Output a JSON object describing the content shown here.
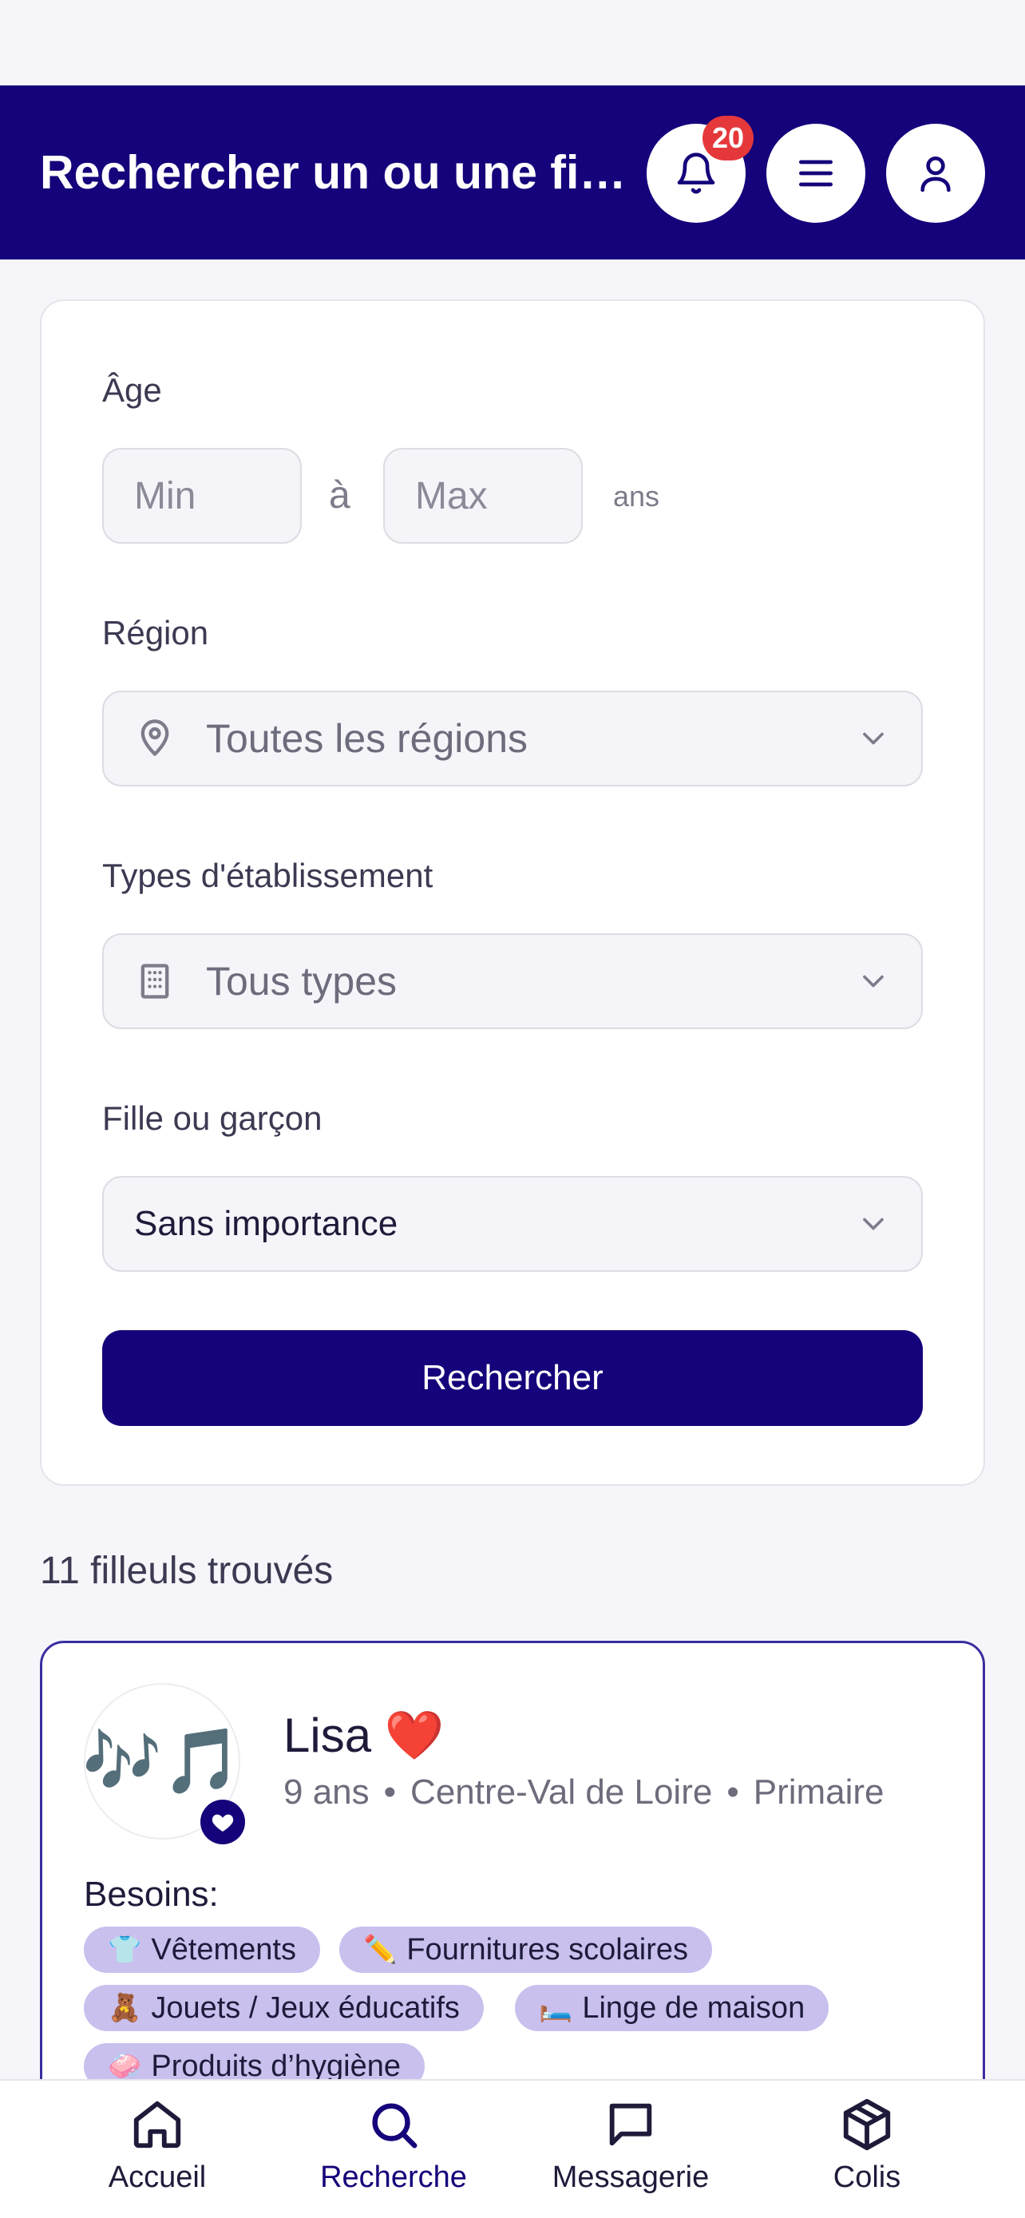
{
  "header": {
    "title": "Rechercher un ou une filleul(e)",
    "notification_count": "20",
    "bell_icon": "bell-icon",
    "menu_icon": "menu-icon",
    "user_icon": "user-icon"
  },
  "filters": {
    "age_label": "Âge",
    "age_min_placeholder": "Min",
    "age_to": "à",
    "age_max_placeholder": "Max",
    "age_unit": "ans",
    "region_label": "Région",
    "region_value": "Toutes les régions",
    "type_label": "Types d'établissement",
    "type_value": "Tous types",
    "gender_label": "Fille ou garçon",
    "gender_value": "Sans importance",
    "search_button": "Rechercher"
  },
  "results": {
    "count_text": "11 filleuls trouvés",
    "items": [
      {
        "avatar": "🎶🎵",
        "name": "Lisa ❤️",
        "age": "9 ans",
        "region": "Centre-Val de Loire",
        "level": "Primaire",
        "needs_label": "Besoins:",
        "needs": [
          {
            "emoji": "👕",
            "label": "Vêtements"
          },
          {
            "emoji": "✏️",
            "label": "Fournitures scolaires"
          },
          {
            "emoji": "🧸",
            "label": "Jouets / Jeux éducatifs"
          },
          {
            "emoji": "🛏️",
            "label": "Linge de maison"
          },
          {
            "emoji": "🧼",
            "label": "Produits d’hygiène"
          }
        ]
      }
    ]
  },
  "bottom_nav": {
    "items": [
      {
        "label": "Accueil",
        "icon": "home-icon"
      },
      {
        "label": "Recherche",
        "icon": "search-icon",
        "active": true
      },
      {
        "label": "Messagerie",
        "icon": "message-icon"
      },
      {
        "label": "Colis",
        "icon": "package-icon"
      }
    ]
  },
  "colors": {
    "primary": "#14037a",
    "badge": "#e5383b",
    "tag": "#c9c0ee"
  }
}
